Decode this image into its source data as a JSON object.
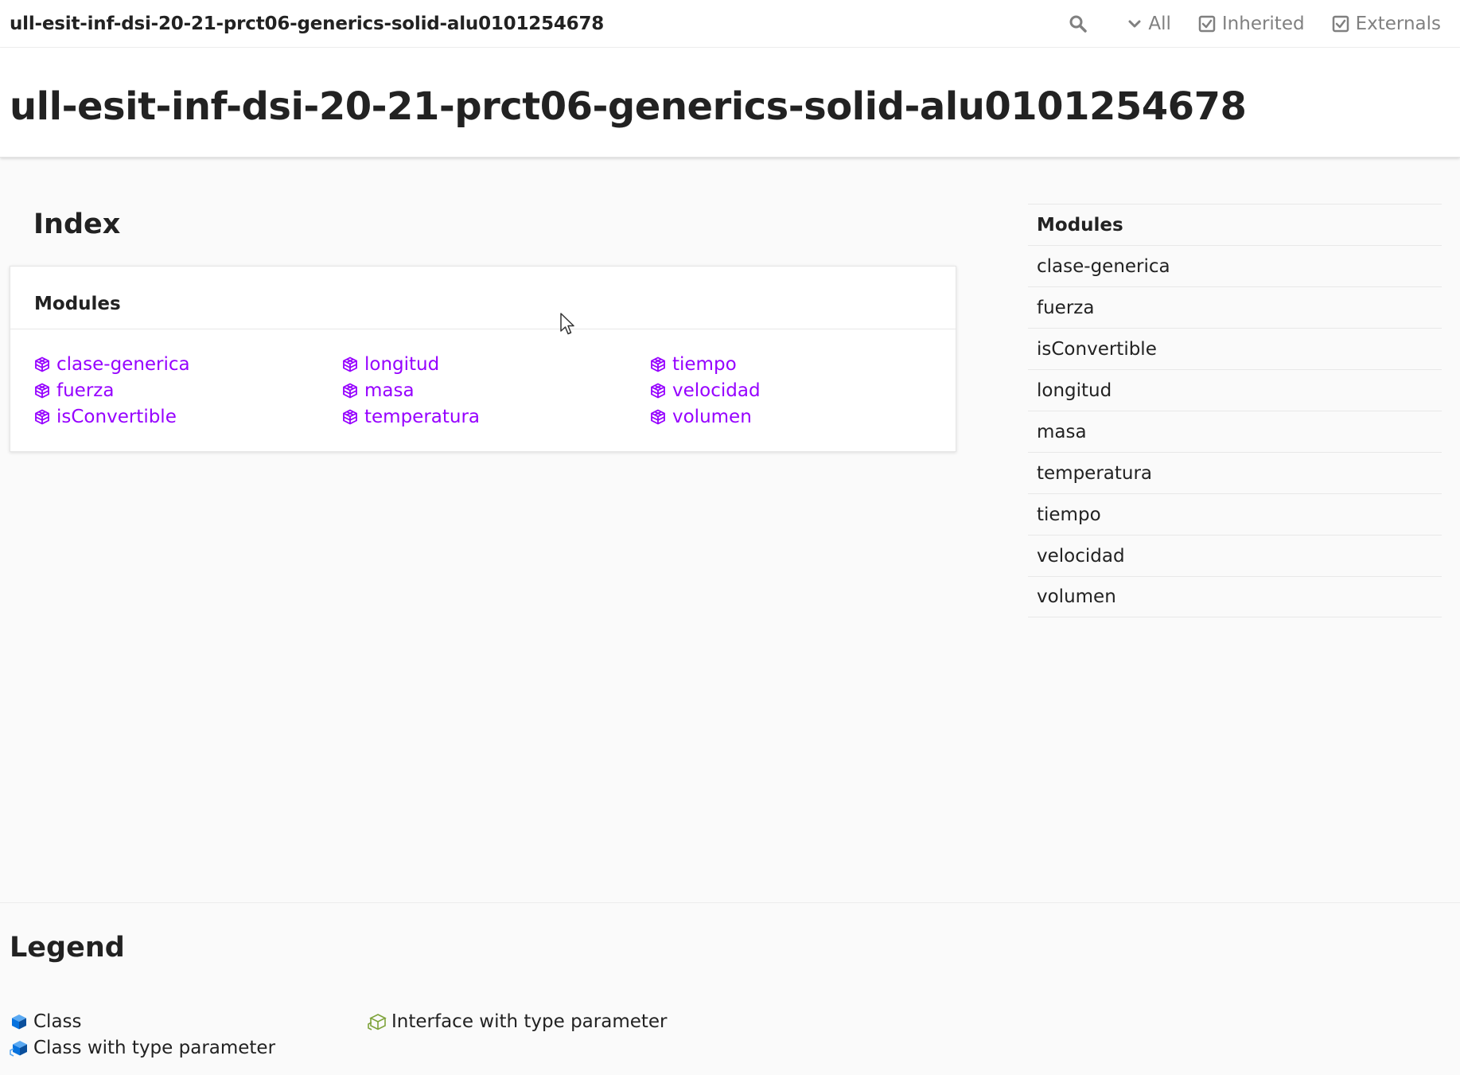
{
  "toolbar": {
    "title": "ull-esit-inf-dsi-20-21-prct06-generics-solid-alu0101254678",
    "search_icon": "search-icon",
    "visibility_label": "All",
    "inherited_label": "Inherited",
    "externals_label": "Externals",
    "inherited_checked": true,
    "externals_checked": true
  },
  "header": {
    "title": "ull-esit-inf-dsi-20-21-prct06-generics-solid-alu0101254678"
  },
  "index": {
    "heading": "Index",
    "card_heading": "Modules",
    "modules": [
      {
        "label": "clase-generica",
        "icon": "module-icon"
      },
      {
        "label": "fuerza",
        "icon": "module-icon"
      },
      {
        "label": "isConvertible",
        "icon": "module-icon"
      },
      {
        "label": "longitud",
        "icon": "module-icon"
      },
      {
        "label": "masa",
        "icon": "module-icon"
      },
      {
        "label": "temperatura",
        "icon": "module-icon"
      },
      {
        "label": "tiempo",
        "icon": "module-icon"
      },
      {
        "label": "velocidad",
        "icon": "module-icon"
      },
      {
        "label": "volumen",
        "icon": "module-icon"
      }
    ]
  },
  "sidebar": {
    "heading": "Modules",
    "items": [
      {
        "label": "clase-generica"
      },
      {
        "label": "fuerza"
      },
      {
        "label": "isConvertible"
      },
      {
        "label": "longitud"
      },
      {
        "label": "masa"
      },
      {
        "label": "temperatura"
      },
      {
        "label": "tiempo"
      },
      {
        "label": "velocidad"
      },
      {
        "label": "volumen"
      }
    ]
  },
  "legend": {
    "heading": "Legend",
    "items": [
      {
        "label": "Class",
        "icon": "class-icon"
      },
      {
        "label": "Class with type parameter",
        "icon": "class-type-parameter-icon"
      },
      {
        "label": "Interface with type parameter",
        "icon": "interface-type-parameter-icon"
      }
    ]
  },
  "colors": {
    "module_link": "#9600ff",
    "class_icon": "#0672de",
    "interface_icon": "#647f1b",
    "text": "#222222",
    "muted": "#808080"
  }
}
